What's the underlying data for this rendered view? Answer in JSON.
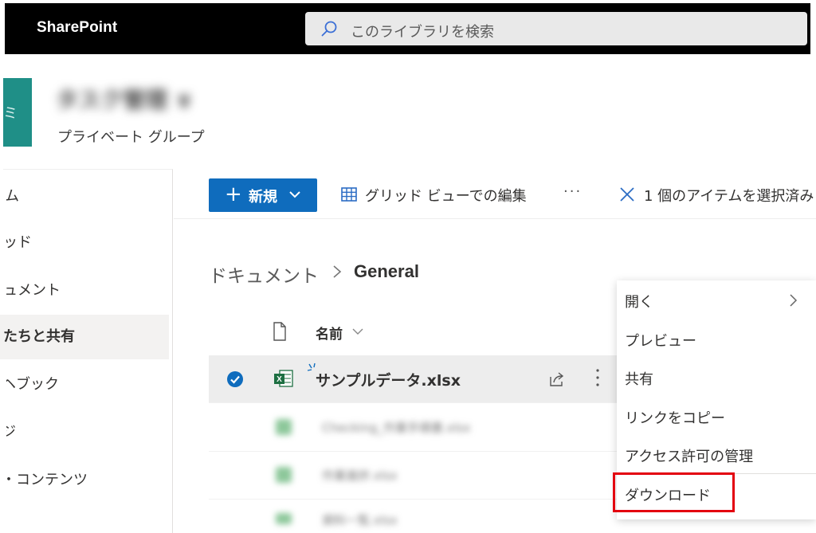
{
  "topbar": {
    "brand": "SharePoint",
    "search_placeholder": "このライブラリを検索"
  },
  "site": {
    "tile_letter": "ミ",
    "title": "タスク管理 ∨",
    "subtitle": "プライベート グループ"
  },
  "leftnav": {
    "items": [
      {
        "label": "ム",
        "selected": false
      },
      {
        "label": "ッド",
        "selected": false
      },
      {
        "label": "ュメント",
        "selected": false
      },
      {
        "label": "たちと共有",
        "selected": true
      },
      {
        "label": "ヘブック",
        "selected": false
      },
      {
        "label": "ジ",
        "selected": false
      },
      {
        "label": "・コンテンツ",
        "selected": false
      }
    ]
  },
  "command_bar": {
    "new_label": "新規",
    "grid_edit_label": "グリッド ビューでの編集",
    "more_label": "···",
    "selection_label": "1 個のアイテムを選択済み"
  },
  "breadcrumb": {
    "parent": "ドキュメント",
    "current": "General"
  },
  "list": {
    "column_name": "名前",
    "selected_file": "サンプルデータ.xlsx",
    "blurred_files": [
      "Checking_作業手順書.xlsx",
      "作業進捗.xlsx",
      "資料一覧.xlsx"
    ]
  },
  "context_menu": {
    "items": [
      {
        "label": "開く",
        "has_submenu": true
      },
      {
        "label": "プレビュー",
        "has_submenu": false
      },
      {
        "label": "共有",
        "has_submenu": false
      },
      {
        "label": "リンクをコピー",
        "has_submenu": false
      },
      {
        "label": "アクセス許可の管理",
        "has_submenu": false
      },
      {
        "label": "ダウンロード",
        "has_submenu": false
      }
    ]
  },
  "colors": {
    "topbar": "#000000",
    "accent": "#0f6cbd",
    "site_tile": "#1f8f87",
    "highlight": "#e3000f",
    "excel_green": "#1d6f42"
  },
  "icons": [
    "search-icon",
    "plus-icon",
    "chevron-down-icon",
    "grid-icon",
    "more-icon",
    "close-icon",
    "chevron-right-icon",
    "document-icon",
    "check-circle-icon",
    "excel-icon",
    "share-icon"
  ]
}
